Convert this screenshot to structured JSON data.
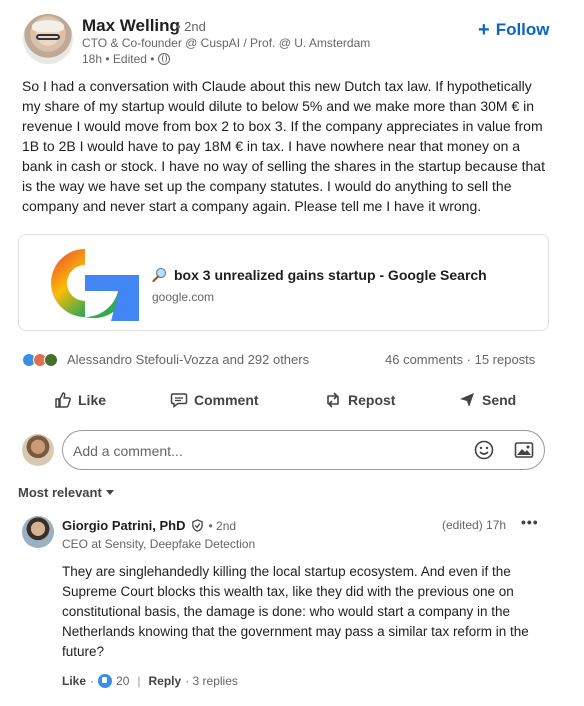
{
  "post": {
    "author": {
      "name": "Max Welling",
      "degree": "• 2nd",
      "headline": "CTO & Co-founder @ CuspAI / Prof. @ U. Amsterdam",
      "meta": "18h • Edited •"
    },
    "follow_label": "Follow",
    "follow_plus": "+",
    "text": "So I had a conversation with Claude about this new Dutch tax law. If hypothetically my share of my startup would dilute to below 5% and we make more than 30M € in revenue I would move from box 2 to box 3. If the company appreciates in value from 1B to 2B I would have to pay 18M € in tax. I have nowhere near that money on a bank in cash or stock. I have no way of selling the shares in the startup because that is the way we have set up the company statutes. I would do anything to sell the company and never start a company again. Please tell me I have it wrong.",
    "link": {
      "title": "box 3 unrealized gains startup - Google Search",
      "domain": "google.com"
    },
    "reactions_text": "Alessandro Stefouli-Vozza and 292 others",
    "counts_text": "46 comments · 15 reposts"
  },
  "actions": {
    "like": "Like",
    "comment": "Comment",
    "repost": "Repost",
    "send": "Send"
  },
  "comment_box": {
    "placeholder": "Add a comment..."
  },
  "sort_label": "Most relevant",
  "comment": {
    "name": "Giorgio Patrini, PhD",
    "degree": "• 2nd",
    "headline": "CEO at Sensity, Deepfake Detection",
    "time": "(edited) 17h",
    "more": "•••",
    "text": "They are singlehandedly killing the local startup ecosystem. And even if the Supreme Court blocks this wealth tax, like they did with the previous one on constitutional basis, the damage is done: who would start a company in the Netherlands knowing that the government may pass a similar tax reform in the future?",
    "like_label": "Like",
    "dot1": "·",
    "like_count": "20",
    "separator": "|",
    "reply_label": "Reply",
    "replies": "· 3 replies"
  },
  "colors": {
    "accent": "#0a66c2",
    "text": "#1f1f1f",
    "muted": "#666666"
  }
}
